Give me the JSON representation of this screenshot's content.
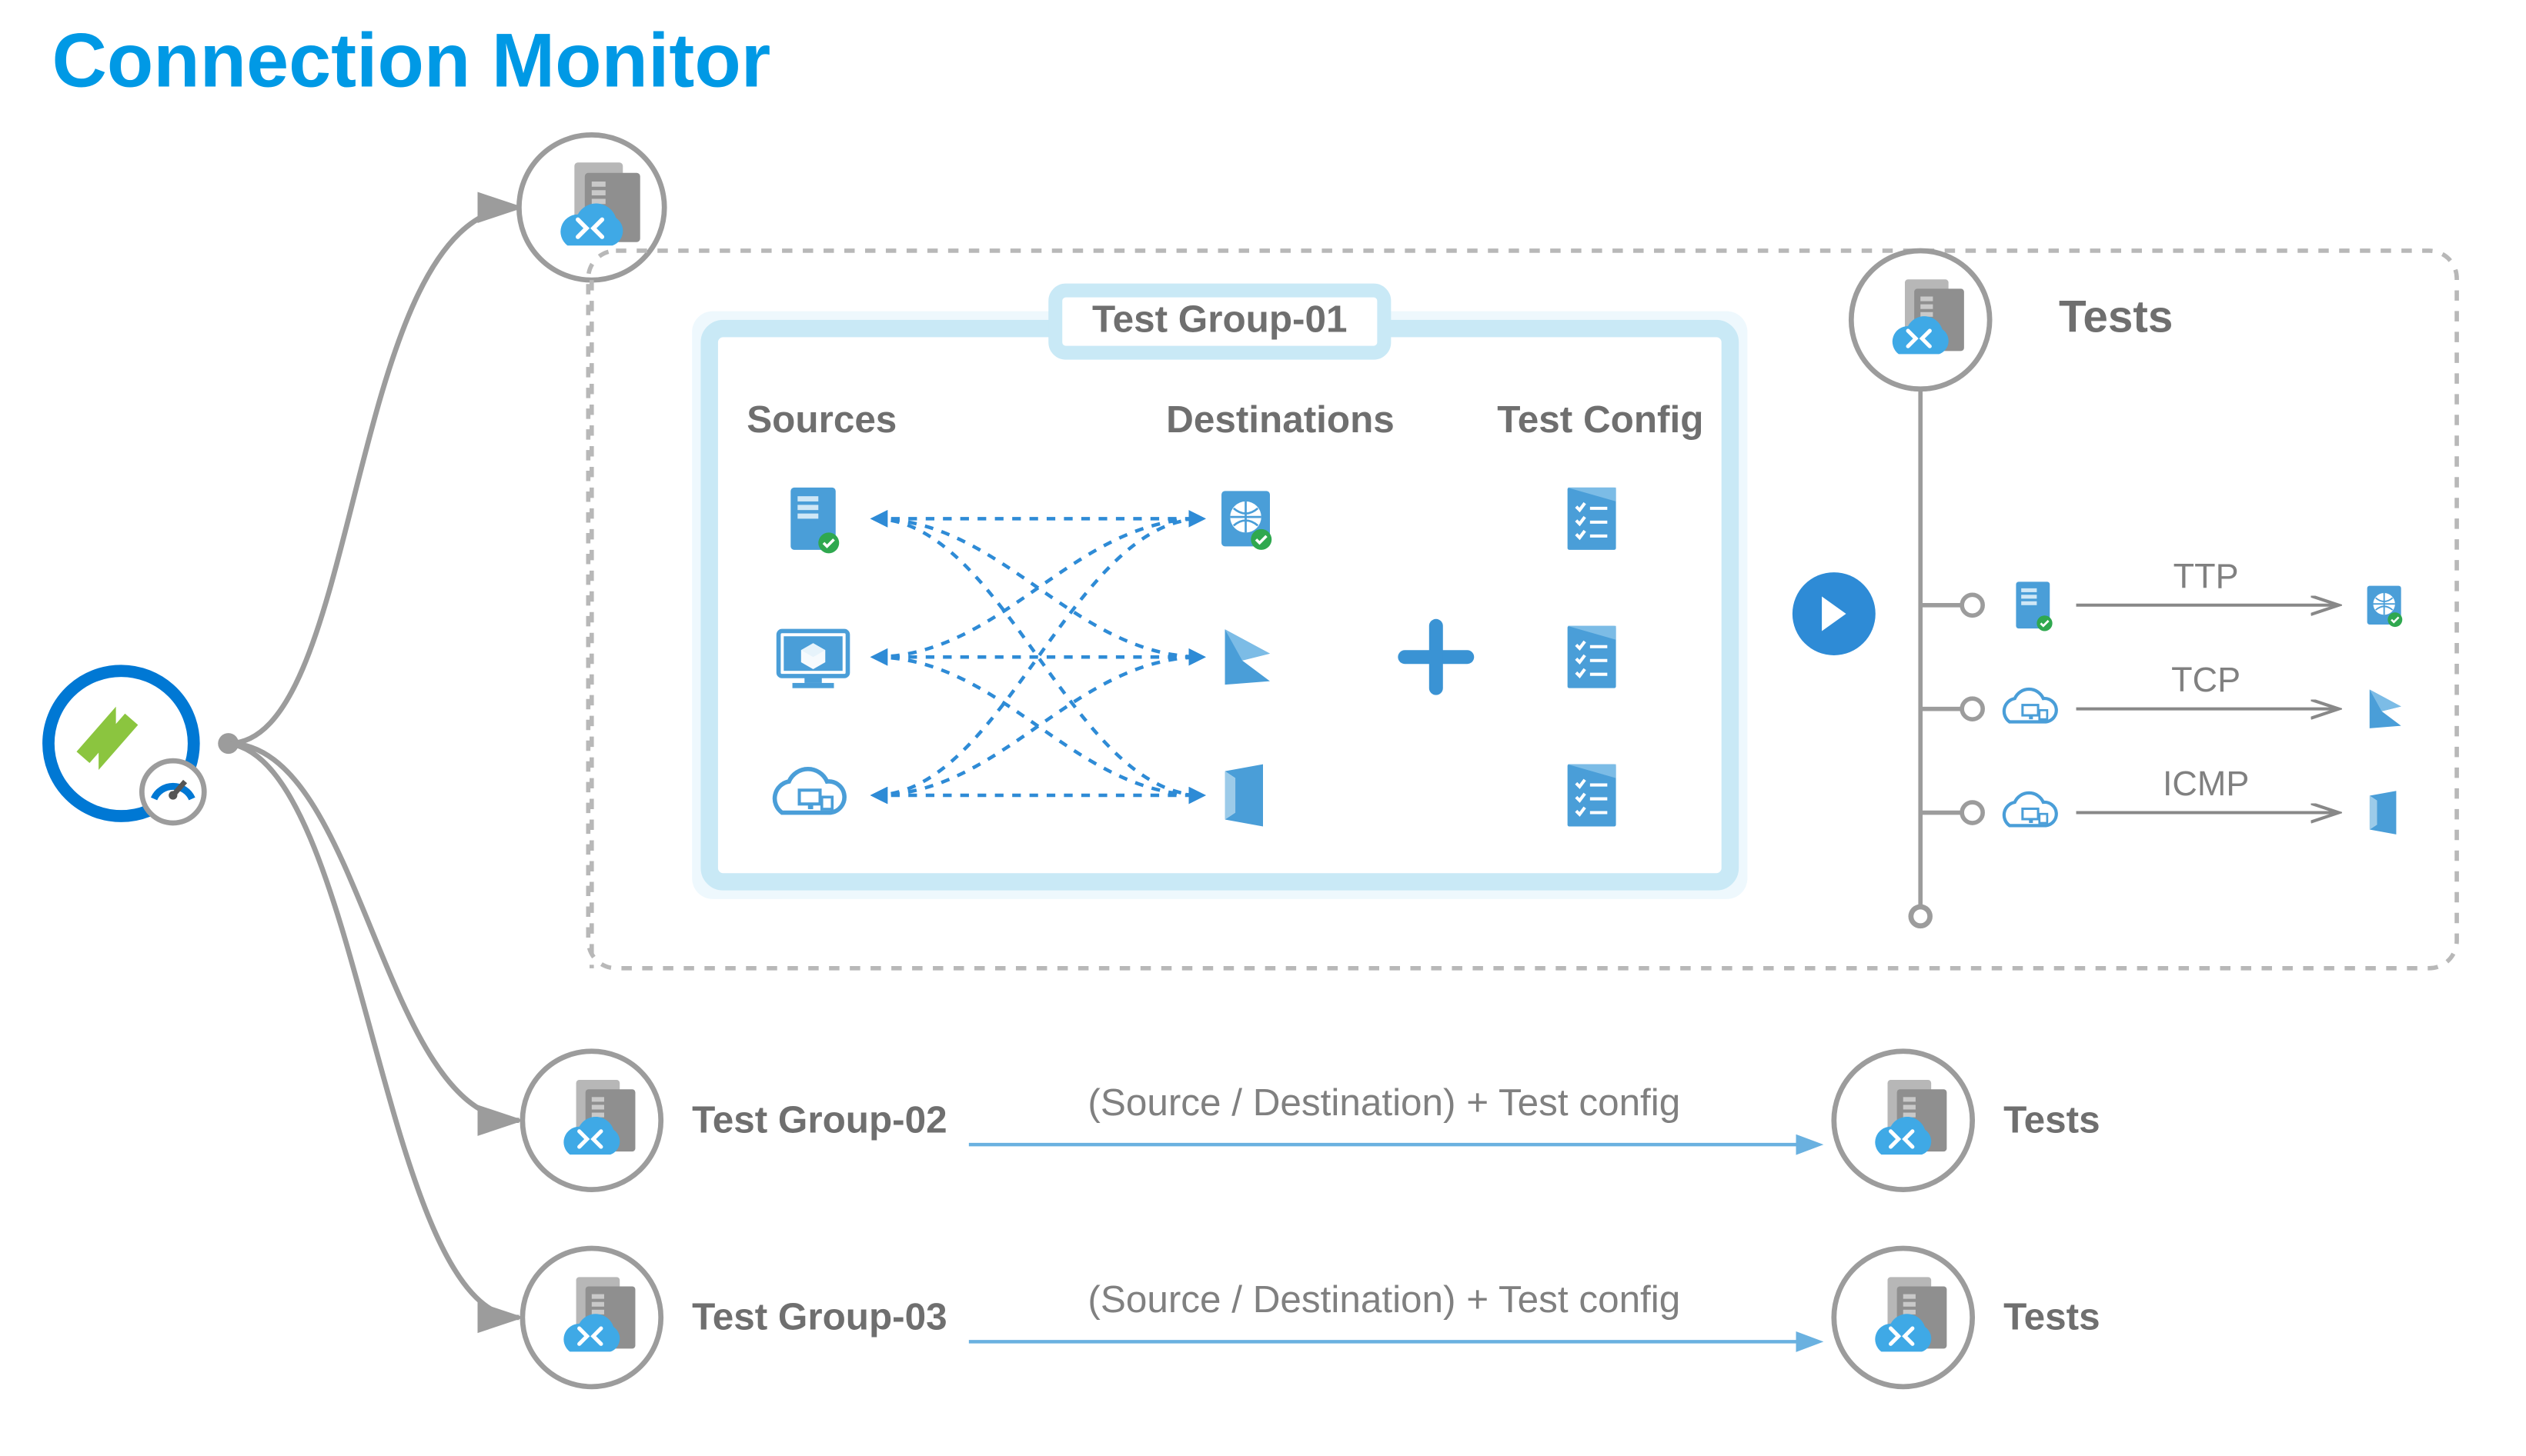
{
  "title": "Connection Monitor",
  "testGroup": {
    "heading": "Test Group-01",
    "cols": {
      "sources": "Sources",
      "destinations": "Destinations",
      "config": "Test Config"
    }
  },
  "testsHeading": "Tests",
  "protocols": {
    "ttp": "TTP",
    "tcp": "TCP",
    "icmp": "ICMP"
  },
  "rows": {
    "r2": {
      "label": "Test Group-02",
      "mid": "(Source / Destination) + Test config",
      "tests": "Tests"
    },
    "r3": {
      "label": "Test Group-03",
      "mid": "(Source / Destination) + Test config",
      "tests": "Tests"
    }
  },
  "colors": {
    "blue": "#2e8bd6",
    "lightBlue": "#c9e9f6",
    "paleBlue": "#eef8fd",
    "grey": "#9c9c9c",
    "darkGrey": "#6f6f6f",
    "iconBlue": "#4a9ed8",
    "accent": "#0099e5",
    "green": "#8bc53f"
  }
}
